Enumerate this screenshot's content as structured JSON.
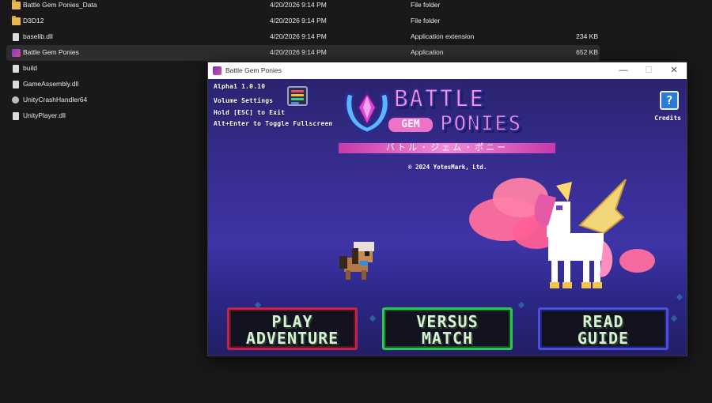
{
  "explorer": {
    "files": [
      {
        "name": "Battle Gem Ponies_Data",
        "date": "4/20/2026 9:14 PM",
        "type": "File folder",
        "size": "",
        "icon": "folder-icon"
      },
      {
        "name": "D3D12",
        "date": "4/20/2026 9:14 PM",
        "type": "File folder",
        "size": "",
        "icon": "folder-icon"
      },
      {
        "name": "baselib.dll",
        "date": "4/20/2026 9:14 PM",
        "type": "Application extension",
        "size": "234 KB",
        "icon": "dll-file-icon"
      },
      {
        "name": "Battle Gem Ponies",
        "date": "4/20/2026 9:14 PM",
        "type": "Application",
        "size": "652 KB",
        "icon": "app-icon"
      },
      {
        "name": "build",
        "date": "",
        "type": "",
        "size": "",
        "icon": "file-icon"
      },
      {
        "name": "GameAssembly.dll",
        "date": "",
        "type": "",
        "size": "",
        "icon": "dll-file-icon"
      },
      {
        "name": "UnityCrashHandler64",
        "date": "",
        "type": "",
        "size": "",
        "icon": "gear-icon"
      },
      {
        "name": "UnityPlayer.dll",
        "date": "",
        "type": "",
        "size": "",
        "icon": "dll-file-icon"
      }
    ]
  },
  "window": {
    "title": "Battle Gem Ponies",
    "minimize": "—",
    "maximize": "☐",
    "close": "✕"
  },
  "game": {
    "version": "Alpha1 1.0.10",
    "volume_settings": "Volume Settings",
    "hold_esc": "Hold [ESC] to Exit",
    "fullscreen_hint": "Alt+Enter to Toggle Fullscreen",
    "credits_icon": "?",
    "credits_label": "Credits",
    "logo_battle": "BATTLE",
    "logo_gem": "GEM",
    "logo_ponies": "PONIES",
    "logo_japanese": "バトル・ジェム・ポニー",
    "copyright": "© 2024 YotesMark, Ltd.",
    "buttons": {
      "play_line1": "PLAY",
      "play_line2": "ADVENTURE",
      "versus_line1": "VERSUS",
      "versus_line2": "MATCH",
      "read_line1": "READ",
      "read_line2": "GUIDE"
    },
    "colors": {
      "play_border": "#c0264c",
      "versus_border": "#29c853",
      "read_border": "#4a4fe0",
      "logo_pink": "#ff8fd6",
      "background": "#3a2f96"
    }
  }
}
